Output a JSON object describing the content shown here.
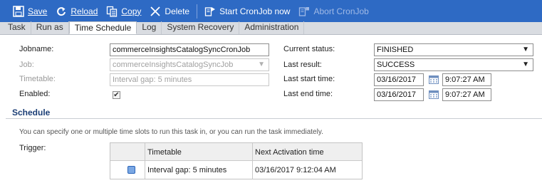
{
  "toolbar": {
    "save": "Save",
    "reload": "Reload",
    "copy": "Copy",
    "delete": "Delete",
    "start": "Start CronJob now",
    "abort": "Abort CronJob"
  },
  "tabs": [
    "Task",
    "Run as",
    "Time Schedule",
    "Log",
    "System Recovery",
    "Administration"
  ],
  "form": {
    "jobname_label": "Jobname:",
    "jobname_value": "commerceInsightsCatalogSyncCronJob",
    "job_label": "Job:",
    "job_value": "commerceInsightsCatalogSyncJob",
    "timetable_label": "Timetable:",
    "timetable_value": "Interval gap: 5 minutes",
    "enabled_label": "Enabled:",
    "enabled_checked": "✔",
    "current_status_label": "Current status:",
    "current_status_value": "FINISHED",
    "last_result_label": "Last result:",
    "last_result_value": "SUCCESS",
    "last_start_label": "Last start time:",
    "last_start_date": "03/16/2017",
    "last_start_time": "9:07:27 AM",
    "last_end_label": "Last end time:",
    "last_end_date": "03/16/2017",
    "last_end_time": "9:07:27 AM"
  },
  "schedule": {
    "title": "Schedule",
    "hint": "You can specify one or multiple time slots to run this task in, or you can run the task immediately.",
    "trigger_label": "Trigger:",
    "columns": [
      "Timetable",
      "Next Activation time"
    ],
    "rows": [
      {
        "timetable": "Interval gap: 5 minutes",
        "next": "03/16/2017 9:12:04 AM"
      }
    ]
  },
  "colors": {
    "toolbar_bg": "#2e6ac4",
    "section_title": "#1b3e76"
  }
}
